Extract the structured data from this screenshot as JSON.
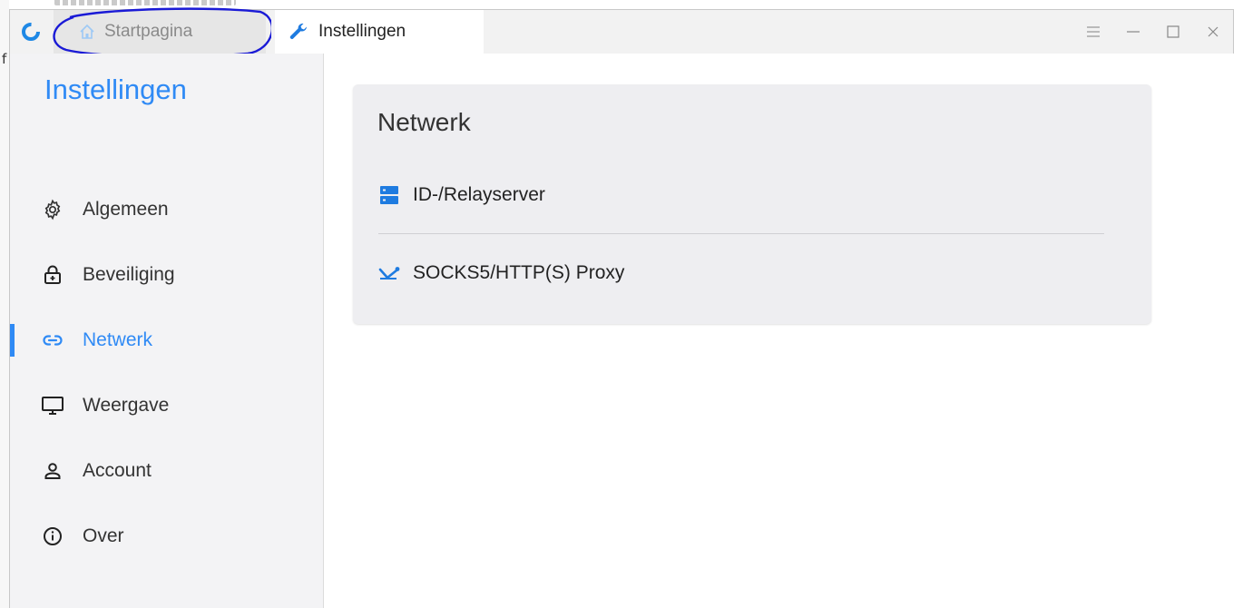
{
  "app": {
    "tabs": [
      {
        "label": "Startpagina",
        "icon": "home-icon"
      },
      {
        "label": "Instellingen",
        "icon": "wrench-icon"
      }
    ]
  },
  "window_controls": [
    "menu-icon",
    "minimize-icon",
    "maximize-icon",
    "close-icon"
  ],
  "sidebar": {
    "title": "Instellingen",
    "items": [
      {
        "label": "Algemeen",
        "icon": "gear-icon"
      },
      {
        "label": "Beveiliging",
        "icon": "lock-icon"
      },
      {
        "label": "Netwerk",
        "icon": "link-icon",
        "active": true
      },
      {
        "label": "Weergave",
        "icon": "monitor-icon"
      },
      {
        "label": "Account",
        "icon": "person-icon"
      },
      {
        "label": "Over",
        "icon": "info-icon"
      }
    ]
  },
  "main": {
    "section_title": "Netwerk",
    "rows": [
      {
        "label": "ID-/Relayserver",
        "icon": "server-icon"
      },
      {
        "label": "SOCKS5/HTTP(S) Proxy",
        "icon": "proxy-icon"
      }
    ]
  },
  "colors": {
    "accent": "#2f8af5",
    "annotation": "#1a1ad6"
  }
}
